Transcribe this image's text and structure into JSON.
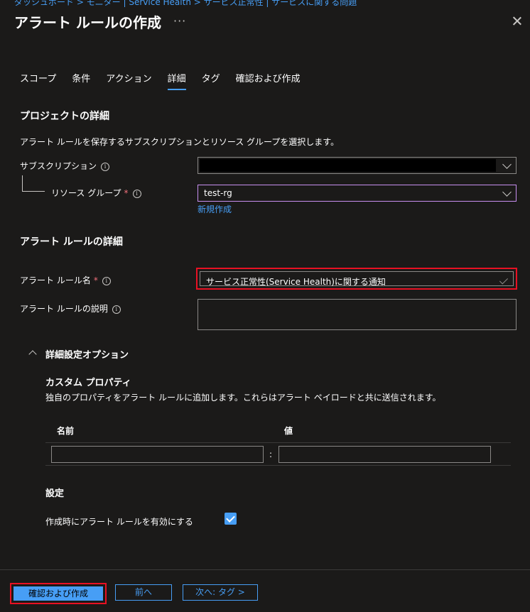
{
  "breadcrumb": "ダッシュボード > モニター | Service Health > サービス正常性 | サービスに関する問題",
  "title": "アラート ルールの作成",
  "title_more": "···",
  "tabs": [
    "スコープ",
    "条件",
    "アクション",
    "詳細",
    "タグ",
    "確認および作成"
  ],
  "active_tab": "詳細",
  "project": {
    "heading": "プロジェクトの詳細",
    "description": "アラート ルールを保存するサブスクリプションとリソース グループを選択します。",
    "subscription_label": "サブスクリプション",
    "resource_group_label": "リソース グループ",
    "required_mark": "*",
    "resource_group_value": "test-rg",
    "new_link": "新規作成"
  },
  "alert": {
    "heading": "アラート ルールの詳細",
    "name_label": "アラート ルール名",
    "name_value": "サービス正常性(Service Health)に関する通知",
    "description_label": "アラート ルールの説明",
    "description_value": ""
  },
  "advanced": {
    "toggle_label": "詳細設定オプション",
    "custom_heading": "カスタム プロパティ",
    "custom_description": "独自のプロパティをアラート ルールに追加します。これらはアラート ペイロードと共に送信されます。",
    "col_name": "名前",
    "col_value": "値",
    "separator": ":",
    "settings_heading": "設定",
    "enable_label": "作成時にアラート ルールを有効にする",
    "enable_checked": true
  },
  "info_glyph": "i",
  "footer": {
    "review_button": "確認および作成",
    "prev_button": "前へ",
    "next_button": "次へ: タグ >"
  },
  "colors": {
    "accent": "#479ef5",
    "highlight": "#e81123",
    "background": "#1b1a19"
  }
}
